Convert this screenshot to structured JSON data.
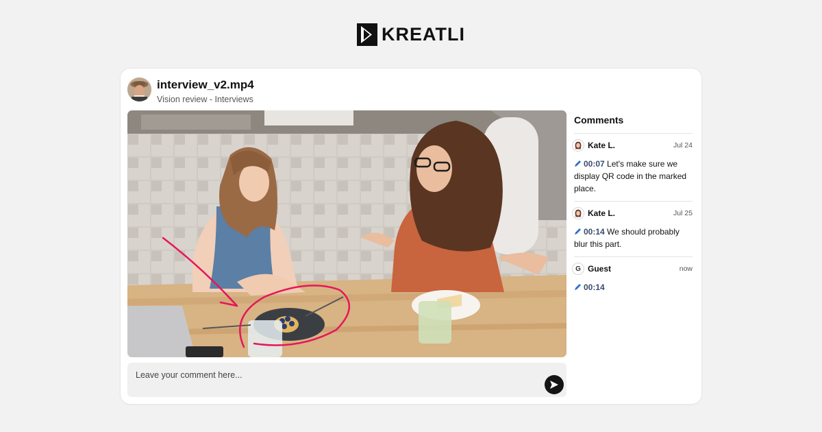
{
  "brand": {
    "name": "KREATLI"
  },
  "file": {
    "title": "interview_v2.mp4",
    "subtitle": "Vision review - Interviews"
  },
  "composer": {
    "placeholder": "Leave your comment here...",
    "value": ""
  },
  "sidebar": {
    "title": "Comments",
    "comments": [
      {
        "author": "Kate L.",
        "date": "Jul 24",
        "timestamp": "00:07",
        "text": "Let's make sure we display QR code in the marked place."
      },
      {
        "author": "Kate L.",
        "date": "Jul 25",
        "timestamp": "00:14",
        "text": "We should probably blur this part."
      },
      {
        "author": "Guest",
        "avatar_letter": "G",
        "date": "now",
        "timestamp": "00:14",
        "text": ""
      }
    ]
  },
  "colors": {
    "background": "#f2f2f2",
    "annotation": "#e5175a",
    "timestamp": "#3a4b6e",
    "send_button": "#151515"
  },
  "icons": [
    "kreatli-logo-icon",
    "pen-icon",
    "send-icon"
  ]
}
